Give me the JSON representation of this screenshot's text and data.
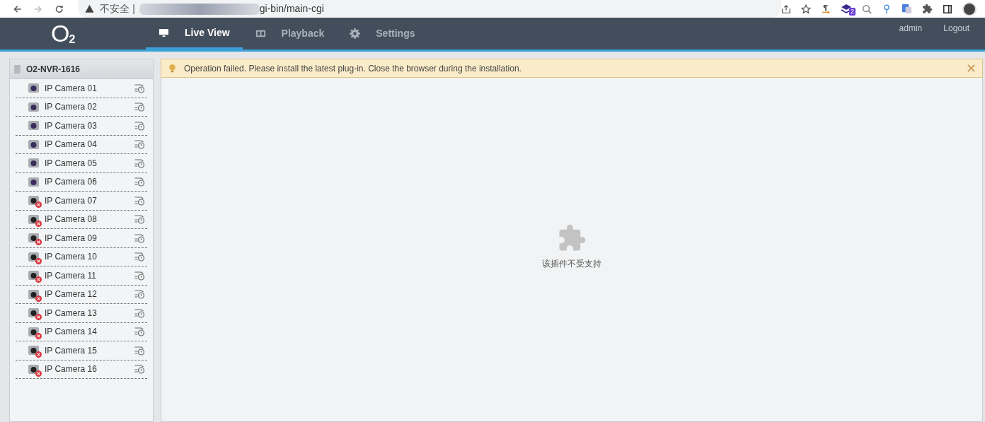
{
  "browser": {
    "security": "不安全 |",
    "url": "gi-bin/main-cgi",
    "extension_badge": "2"
  },
  "header": {
    "logo": {
      "letter": "O",
      "subscript": "2"
    },
    "tabs": [
      {
        "label": "Live View",
        "kind": "monitor",
        "selected": true
      },
      {
        "label": "Playback",
        "kind": "film",
        "selected": false
      },
      {
        "label": "Settings",
        "kind": "gear",
        "selected": false
      }
    ],
    "user": "admin",
    "logout": "Logout"
  },
  "sidebar": {
    "device": "O2-NVR-1616",
    "cameras": [
      {
        "name": "IP Camera 01",
        "offline": false
      },
      {
        "name": "IP Camera 02",
        "offline": false
      },
      {
        "name": "IP Camera 03",
        "offline": false
      },
      {
        "name": "IP Camera 04",
        "offline": false
      },
      {
        "name": "IP Camera 05",
        "offline": false
      },
      {
        "name": "IP Camera 06",
        "offline": false
      },
      {
        "name": "IP Camera 07",
        "offline": true
      },
      {
        "name": "IP Camera 08",
        "offline": true
      },
      {
        "name": "IP Camera 09",
        "offline": true
      },
      {
        "name": "IP Camera 10",
        "offline": true
      },
      {
        "name": "IP Camera 11",
        "offline": true
      },
      {
        "name": "IP Camera 12",
        "offline": true
      },
      {
        "name": "IP Camera 13",
        "offline": true
      },
      {
        "name": "IP Camera 14",
        "offline": true
      },
      {
        "name": "IP Camera 15",
        "offline": true
      },
      {
        "name": "IP Camera 16",
        "offline": true
      }
    ]
  },
  "banner": {
    "message": "Operation failed. Please install the latest plug-in. Close the browser during the installation."
  },
  "plugin": {
    "message": "该插件不受支持"
  }
}
